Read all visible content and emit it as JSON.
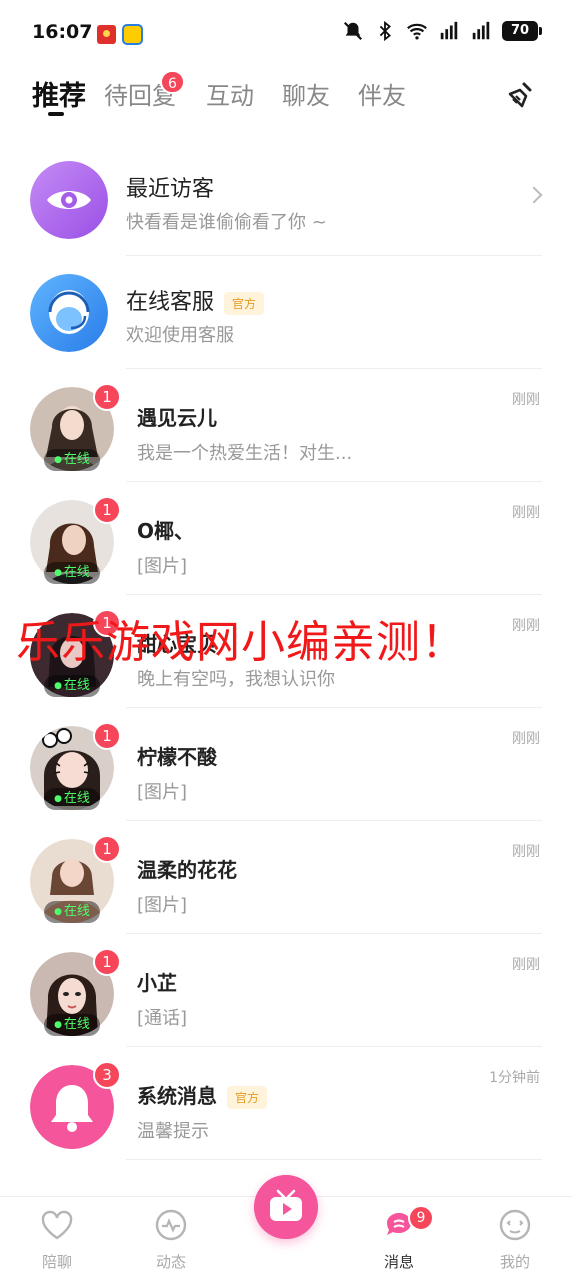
{
  "status_bar": {
    "time": "16:07",
    "battery": "70"
  },
  "tabs": [
    {
      "label": "推荐"
    },
    {
      "label": "待回复",
      "badge": "6"
    },
    {
      "label": "互动"
    },
    {
      "label": "聊友"
    },
    {
      "label": "伴友"
    }
  ],
  "conversations": [
    {
      "name": "最近访客",
      "preview": "快看看是谁偷偷看了你 ~"
    },
    {
      "name": "在线客服",
      "tag": "官方",
      "preview": "欢迎使用客服"
    },
    {
      "name": "遇见云儿",
      "preview": "我是一个热爱生活！对生...",
      "time": "刚刚",
      "unread": "1",
      "status": "在线"
    },
    {
      "name": "O椰、",
      "preview": "[图片]",
      "time": "刚刚",
      "unread": "1",
      "status": "在线"
    },
    {
      "name": "甜心宝贝",
      "preview": "晚上有空吗，我想认识你",
      "time": "刚刚",
      "unread": "1",
      "status": "在线"
    },
    {
      "name": "柠檬不酸",
      "preview": "[图片]",
      "time": "刚刚",
      "unread": "1",
      "status": "在线"
    },
    {
      "name": "温柔的花花",
      "preview": "[图片]",
      "time": "刚刚",
      "unread": "1",
      "status": "在线"
    },
    {
      "name": "小芷",
      "preview": "[通话]",
      "time": "刚刚",
      "unread": "1",
      "status": "在线"
    },
    {
      "name": "系统消息",
      "tag": "官方",
      "preview": "温馨提示",
      "time": "1分钟前",
      "unread": "3"
    }
  ],
  "watermark": "乐乐游戏网小编亲测！",
  "bottom_nav": [
    {
      "label": "陪聊"
    },
    {
      "label": "动态"
    },
    {
      "label": ""
    },
    {
      "label": "消息",
      "badge": "9"
    },
    {
      "label": "我的"
    }
  ],
  "colors": {
    "accent": "#f5465a",
    "brand_pink": "#f5559a",
    "online": "#4dff6a",
    "official_tag": "#e59a1f"
  }
}
